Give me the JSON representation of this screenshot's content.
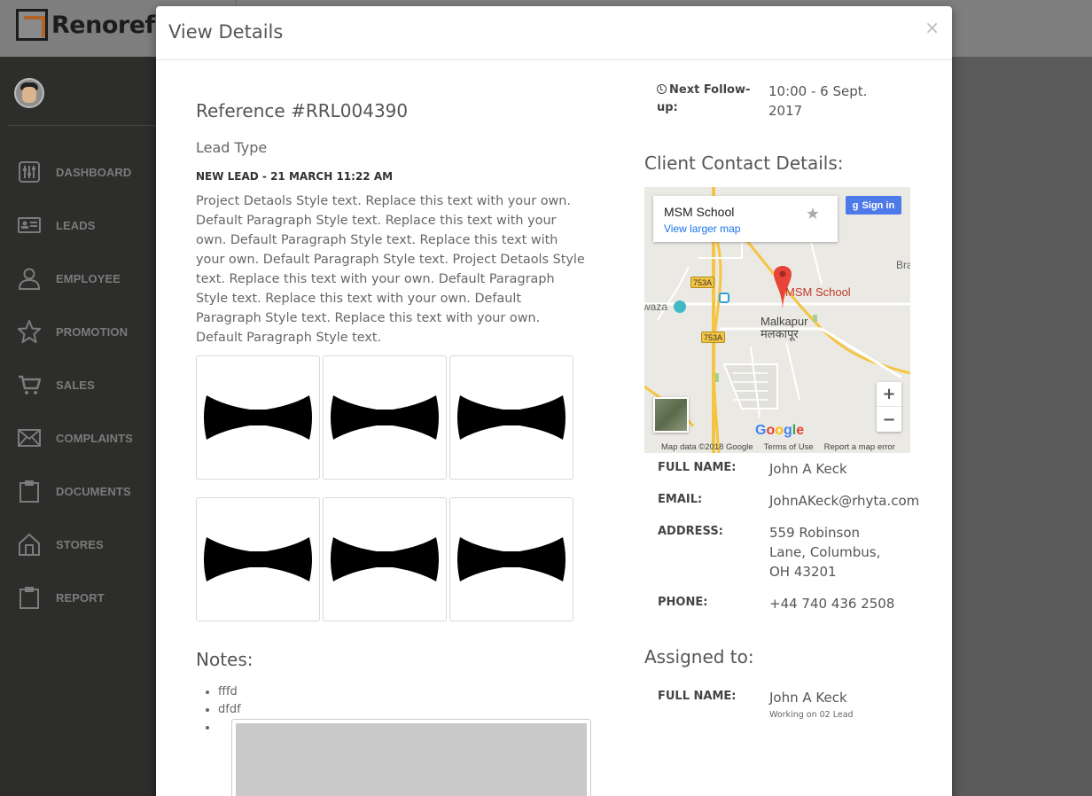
{
  "app": {
    "logo_text": "Renorefe"
  },
  "sidebar": {
    "items": [
      {
        "label": "DASHBOARD",
        "icon": "sliders-icon"
      },
      {
        "label": "LEADS",
        "icon": "id-card-icon"
      },
      {
        "label": "EMPLOYEE",
        "icon": "user-icon"
      },
      {
        "label": "PROMOTION",
        "icon": "star-icon"
      },
      {
        "label": "SALES",
        "icon": "cart-icon"
      },
      {
        "label": "COMPLAINTS",
        "icon": "envelope-icon"
      },
      {
        "label": "DOCUMENTS",
        "icon": "clipboard-icon"
      },
      {
        "label": "STORES",
        "icon": "store-icon"
      },
      {
        "label": "REPORT",
        "icon": "clipboard-icon"
      }
    ]
  },
  "modal": {
    "title": "View Details",
    "close": "×",
    "reference": "Reference #RRL004390",
    "lead_type": "Lead Type",
    "lead_status": "NEW LEAD - 21 MARCH 11:22 AM",
    "description": "Project Detaols Style text. Replace this text with your own. Default Paragraph Style text. Replace this text with your own. Default Paragraph Style text. Replace this text with your own. Default Paragraph Style text. Project Detaols Style text. Replace this text with your own. Default Paragraph Style text. Replace this text with your own. Default Paragraph Style text. Replace this text with your own. Default Paragraph Style text.",
    "notes_title": "Notes:",
    "notes": [
      "fffd",
      "dfdf"
    ],
    "follow_up": {
      "label": "Next Follow-up:",
      "value": "10:00 - 6 Sept. 2017"
    },
    "client_title": "Client Contact Details:",
    "map": {
      "place": "MSM School",
      "larger_map": "View larger map",
      "sign_in": "Sign in",
      "pin_label": "MSM School",
      "town": "Malkapur",
      "town_local": "मलकापूर",
      "edge_label_right": "Bra",
      "edge_label_left": "waza",
      "road_badge": "753A",
      "zoom_in": "+",
      "zoom_out": "−",
      "attribution": [
        "Map data ©2018 Google",
        "Terms of Use",
        "Report a map error"
      ],
      "google_colors": [
        "#4285f4",
        "#ea4335",
        "#fbbc05",
        "#4285f4",
        "#34a853",
        "#ea4335"
      ]
    },
    "client": {
      "full_name_label": "FULL NAME:",
      "full_name": "John A Keck",
      "email_label": "EMAIL:",
      "email": "JohnAKeck@rhyta.com",
      "address_label": "ADDRESS:",
      "address": "559 Robinson Lane, Columbus, OH 43201",
      "phone_label": "PHONE:",
      "phone": "+44 740 436 2508"
    },
    "assigned_title": "Assigned to:",
    "assigned": {
      "full_name_label": "FULL NAME:",
      "full_name": "John A Keck",
      "working": "Working on 02 Lead"
    }
  }
}
